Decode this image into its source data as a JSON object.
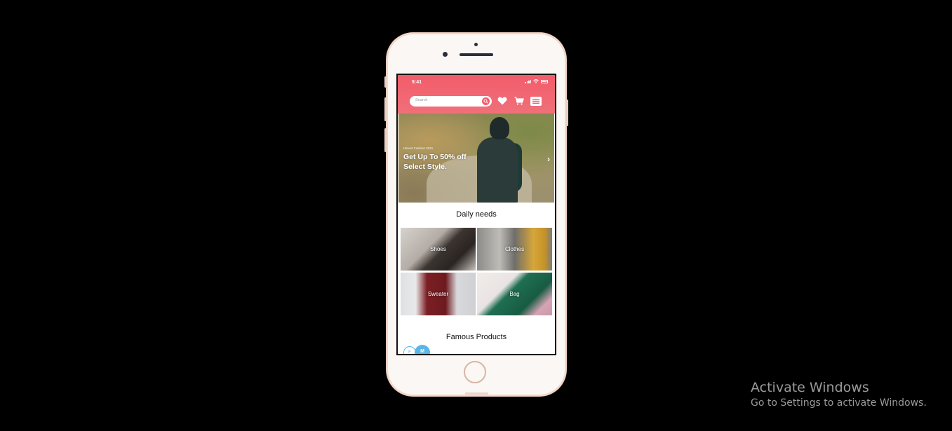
{
  "status_bar": {
    "time": "9:41"
  },
  "header": {
    "search_placeholder": "Search"
  },
  "banner": {
    "subtitle": "Hitevel Fashion 2021",
    "title_line1": "Get Up To 50% off",
    "title_line2": "Select Style."
  },
  "daily_needs": {
    "title": "Daily needs",
    "tiles": [
      {
        "label": "Shoes"
      },
      {
        "label": "Clothes"
      },
      {
        "label": "Sweater"
      },
      {
        "label": "Bag"
      }
    ]
  },
  "famous_products": {
    "title": "Famous Products",
    "toggle": {
      "f": "F",
      "m": "M"
    }
  },
  "watermark": {
    "title": "Activate Windows",
    "subtitle": "Go to Settings to activate Windows."
  },
  "colors": {
    "accent": "#f25c6b",
    "toggle": "#5bb6e8",
    "background": "#000000"
  }
}
